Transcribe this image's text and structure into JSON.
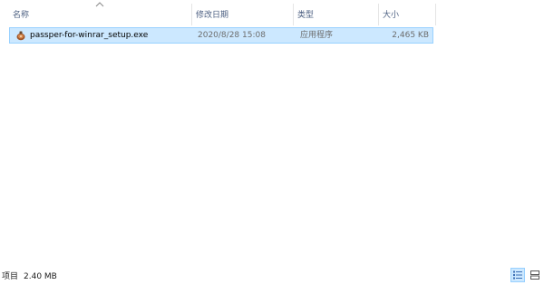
{
  "columns": {
    "name": "名称",
    "date": "修改日期",
    "type": "类型",
    "size": "大小"
  },
  "file": {
    "name": "passper-for-winrar_setup.exe",
    "date": "2020/8/28 15:08",
    "type": "应用程序",
    "size": "2,465 KB"
  },
  "status": {
    "items_label": "项目",
    "size": "2.40 MB"
  },
  "icons": {
    "sort": "sort-ascending-icon",
    "file": "installer-exe-icon",
    "details_view": "details-view-icon",
    "tiles_view": "large-icons-view-icon"
  },
  "colors": {
    "selection_bg": "#cce8ff",
    "selection_border": "#99d1ff",
    "header_text": "#4d6082"
  }
}
